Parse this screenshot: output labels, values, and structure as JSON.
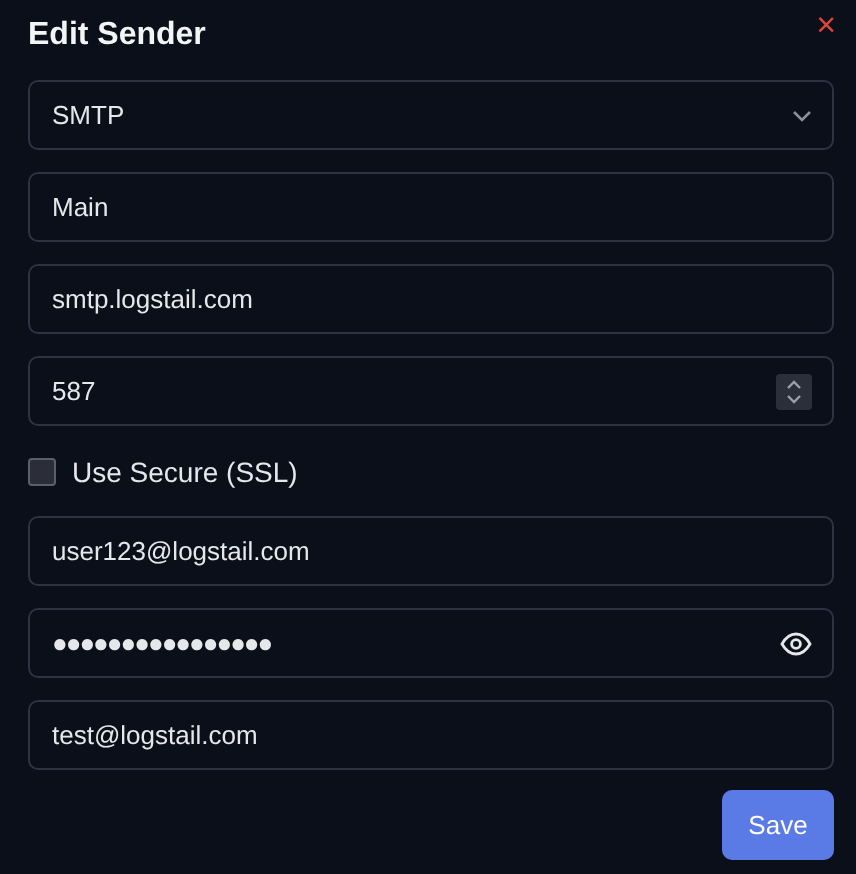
{
  "dialog": {
    "title": "Edit Sender",
    "close_label": "×"
  },
  "fields": [
    {
      "kind": "select",
      "value": "SMTP"
    },
    {
      "kind": "text",
      "value": "Main"
    },
    {
      "kind": "text",
      "value": "smtp.logstail.com"
    },
    {
      "kind": "number",
      "value": "587"
    },
    {
      "kind": "checkbox",
      "label": "Use Secure (SSL)",
      "checked": false
    },
    {
      "kind": "text",
      "value": "user123@logstail.com"
    },
    {
      "kind": "password",
      "value": "●●●●●●●●●●●●●●●●"
    },
    {
      "kind": "text",
      "value": "test@logstail.com"
    }
  ],
  "buttons": [
    {
      "label": "Save"
    }
  ]
}
